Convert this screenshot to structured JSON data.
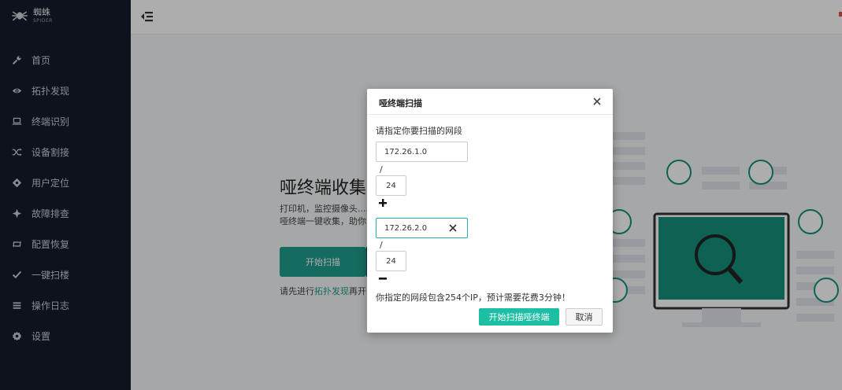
{
  "brand": {
    "name_cn": "蜘蛛",
    "name_en": "SPIDER"
  },
  "sidebar": {
    "items": [
      {
        "label": "首页",
        "icon": "wrench-icon"
      },
      {
        "label": "拓扑发现",
        "icon": "eye-icon"
      },
      {
        "label": "终端识别",
        "icon": "laptop-icon"
      },
      {
        "label": "设备割接",
        "icon": "shuffle-icon"
      },
      {
        "label": "用户定位",
        "icon": "locate-icon"
      },
      {
        "label": "故障排查",
        "icon": "crosshair-icon"
      },
      {
        "label": "配置恢复",
        "icon": "retweet-icon"
      },
      {
        "label": "一键扫楼",
        "icon": "check-icon"
      },
      {
        "label": "操作日志",
        "icon": "list-icon"
      },
      {
        "label": "设置",
        "icon": "gear-icon"
      }
    ]
  },
  "main": {
    "title": "哑终端收集",
    "desc_line1": "打印机，监控摄像头....",
    "desc_line2": "哑终端一键收集，助你",
    "start_button": "开始扫描",
    "note_prefix": "请先进行",
    "note_link": "拓扑发现",
    "note_suffix": "再开"
  },
  "modal": {
    "title": "哑终端扫描",
    "prompt": "请指定你要扫描的网段",
    "segments": [
      {
        "ip": "172.26.1.0",
        "mask": "24"
      },
      {
        "ip": "172.26.2.0",
        "mask": "24"
      }
    ],
    "slash": "/",
    "summary": "你指定的网段包含254个IP，预计需要花费3分钟！",
    "confirm_label": "开始扫描哑终端",
    "cancel_label": "取消"
  },
  "colors": {
    "sidebar_bg": "#151b2b",
    "accent": "#1cbfa4",
    "illustration_screen": "#14917c"
  }
}
